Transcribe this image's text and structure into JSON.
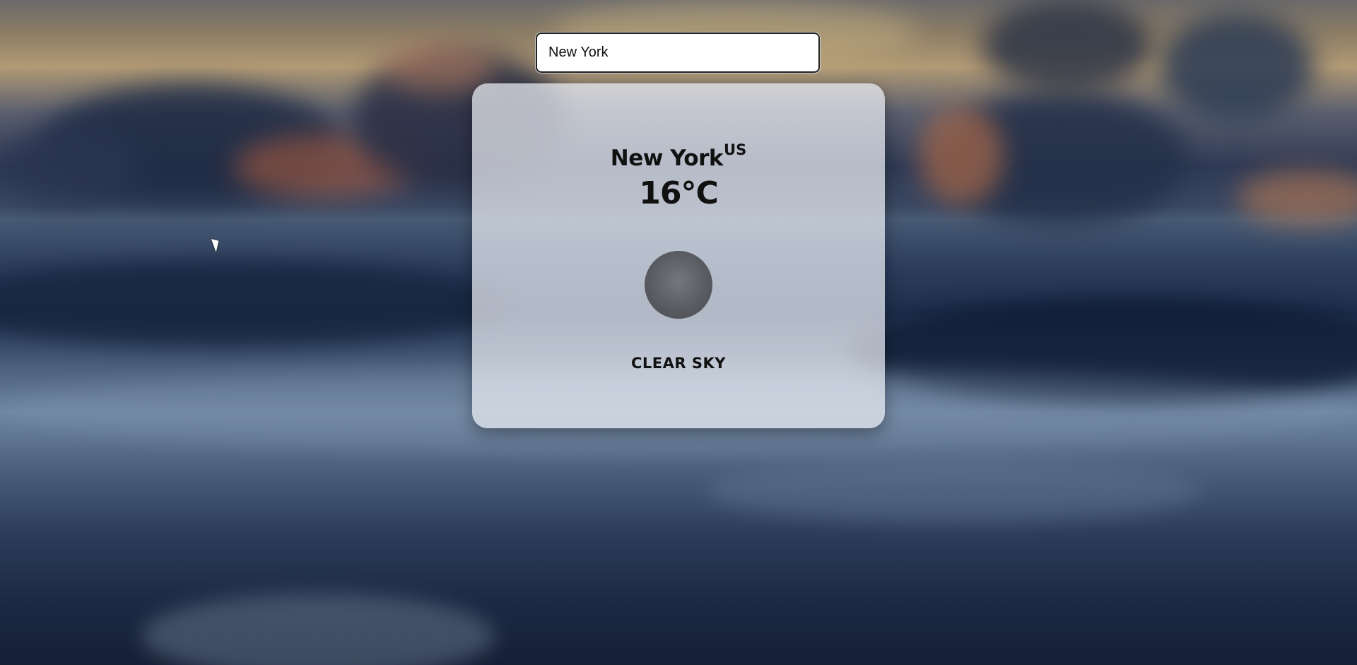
{
  "search": {
    "value": "New York"
  },
  "weather": {
    "city": "New York",
    "country": "US",
    "temperature": "16°C",
    "description": "CLEAR SKY",
    "icon": "weather-circle-icon"
  },
  "colors": {
    "card_background": "#ebeef5",
    "text": "#111111",
    "input_border": "#222222"
  }
}
